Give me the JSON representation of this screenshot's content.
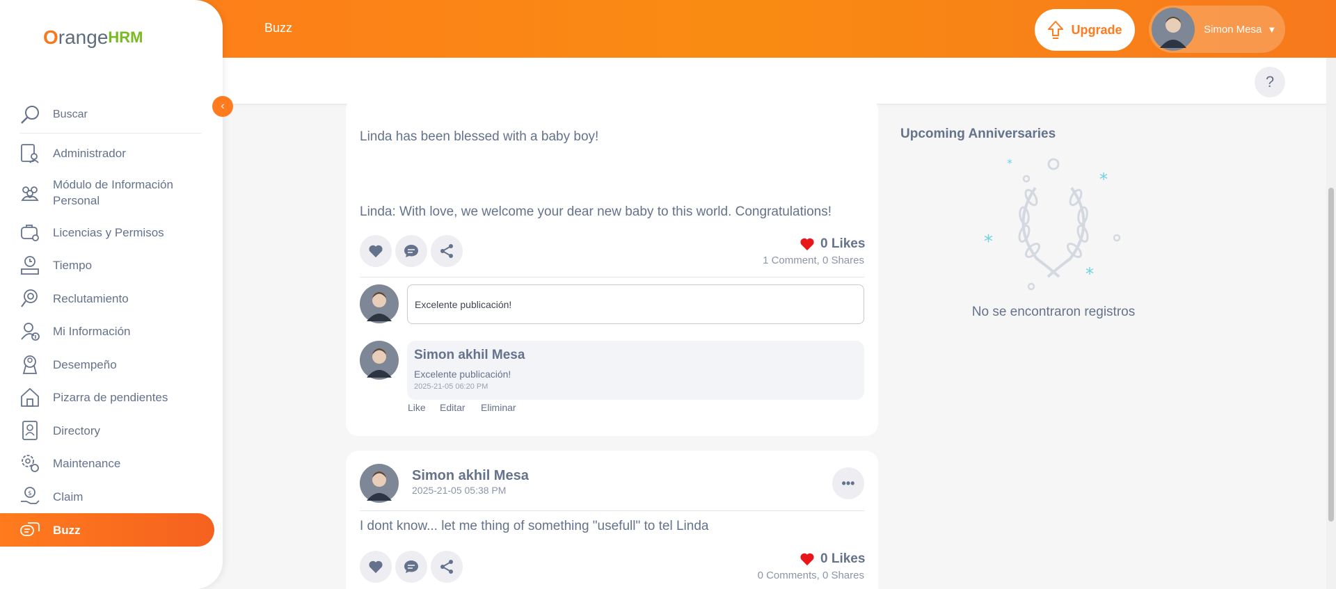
{
  "topbar": {
    "title": "Buzz",
    "upgrade_label": "Upgrade",
    "user_name": "Simon Mesa",
    "help_label": "?"
  },
  "brand": {
    "o": "O",
    "range": "range",
    "hrm": "HRM",
    "color_primary": "#ff7b1d",
    "color_green": "#76bc21"
  },
  "sidebar": {
    "search_label": "Buscar",
    "items": [
      {
        "label": "Administrador",
        "icon": "admin-icon"
      },
      {
        "label": "Módulo de Información Personal",
        "icon": "pim-icon"
      },
      {
        "label": "Licencias y Permisos",
        "icon": "leave-icon"
      },
      {
        "label": "Tiempo",
        "icon": "time-icon"
      },
      {
        "label": "Reclutamiento",
        "icon": "recruitment-icon"
      },
      {
        "label": "Mi Información",
        "icon": "my-info-icon"
      },
      {
        "label": "Desempeño",
        "icon": "performance-icon"
      },
      {
        "label": "Pizarra de pendientes",
        "icon": "dashboard-icon"
      },
      {
        "label": "Directory",
        "icon": "directory-icon"
      },
      {
        "label": "Maintenance",
        "icon": "maintenance-icon"
      },
      {
        "label": "Claim",
        "icon": "claim-icon"
      },
      {
        "label": "Buzz",
        "icon": "buzz-icon",
        "active": true
      }
    ]
  },
  "post1": {
    "text1": "Linda has been blessed with a baby boy!",
    "text2": "Linda: With love, we welcome your dear new baby to this world. Congratulations!",
    "likes": "0 Likes",
    "comments": "1 Comment",
    "shares": "0 Shares",
    "comment_input_value": "Excelente publicación!",
    "comment": {
      "author": "Simon akhil Mesa",
      "text": "Excelente publicación!",
      "date": "2025-21-05 06:20 PM",
      "actions": [
        "Like",
        "Editar",
        "Eliminar"
      ]
    }
  },
  "post2": {
    "author": "Simon akhil Mesa",
    "date": "2025-21-05 05:38 PM",
    "text": "I dont know... let me thing of something \"usefull\" to tel Linda",
    "likes": "0 Likes",
    "comments": "0 Comments",
    "shares": "0 Shares",
    "more_label": "•••"
  },
  "right_panel": {
    "title": "Upcoming Anniversaries",
    "empty_text": "No se encontraron registros"
  }
}
